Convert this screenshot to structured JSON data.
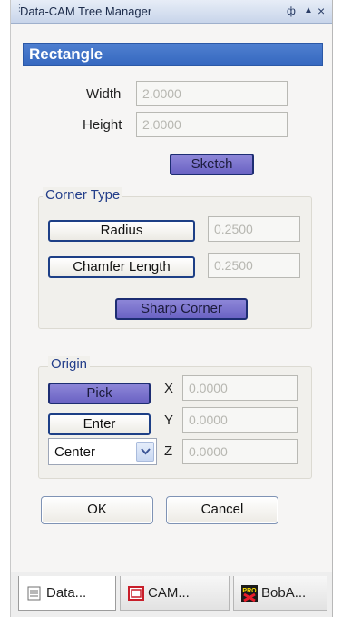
{
  "window": {
    "title": "Data-CAM Tree Manager",
    "pin_glyph": "ф",
    "arrow_glyph": "▲",
    "close_glyph": "×"
  },
  "section": {
    "title": "Rectangle"
  },
  "dimensions": {
    "width_label": "Width",
    "width_value": "2.0000",
    "height_label": "Height",
    "height_value": "2.0000",
    "sketch_label": "Sketch"
  },
  "corner": {
    "title": "Corner Type",
    "radius_label": "Radius",
    "radius_value": "0.2500",
    "chamfer_label": "Chamfer Length",
    "chamfer_value": "0.2500",
    "sharp_label": "Sharp Corner"
  },
  "origin": {
    "title": "Origin",
    "pick_label": "Pick",
    "enter_label": "Enter",
    "mode_value": "Center",
    "x_label": "X",
    "x_value": "0.0000",
    "y_label": "Y",
    "y_value": "0.0000",
    "z_label": "Z",
    "z_value": "0.0000"
  },
  "actions": {
    "ok_label": "OK",
    "cancel_label": "Cancel"
  },
  "tabs": [
    {
      "label": "Data...",
      "icon": "list-icon"
    },
    {
      "label": "CAM...",
      "icon": "cam-icon"
    },
    {
      "label": "BobA...",
      "icon": "pro-icon",
      "icon_text": "PRO"
    }
  ],
  "colors": {
    "header_blue": "#3d6fc6",
    "button_border": "#1d3f86",
    "pressed_button": "#7a73cf",
    "group_title": "#233e8a"
  }
}
